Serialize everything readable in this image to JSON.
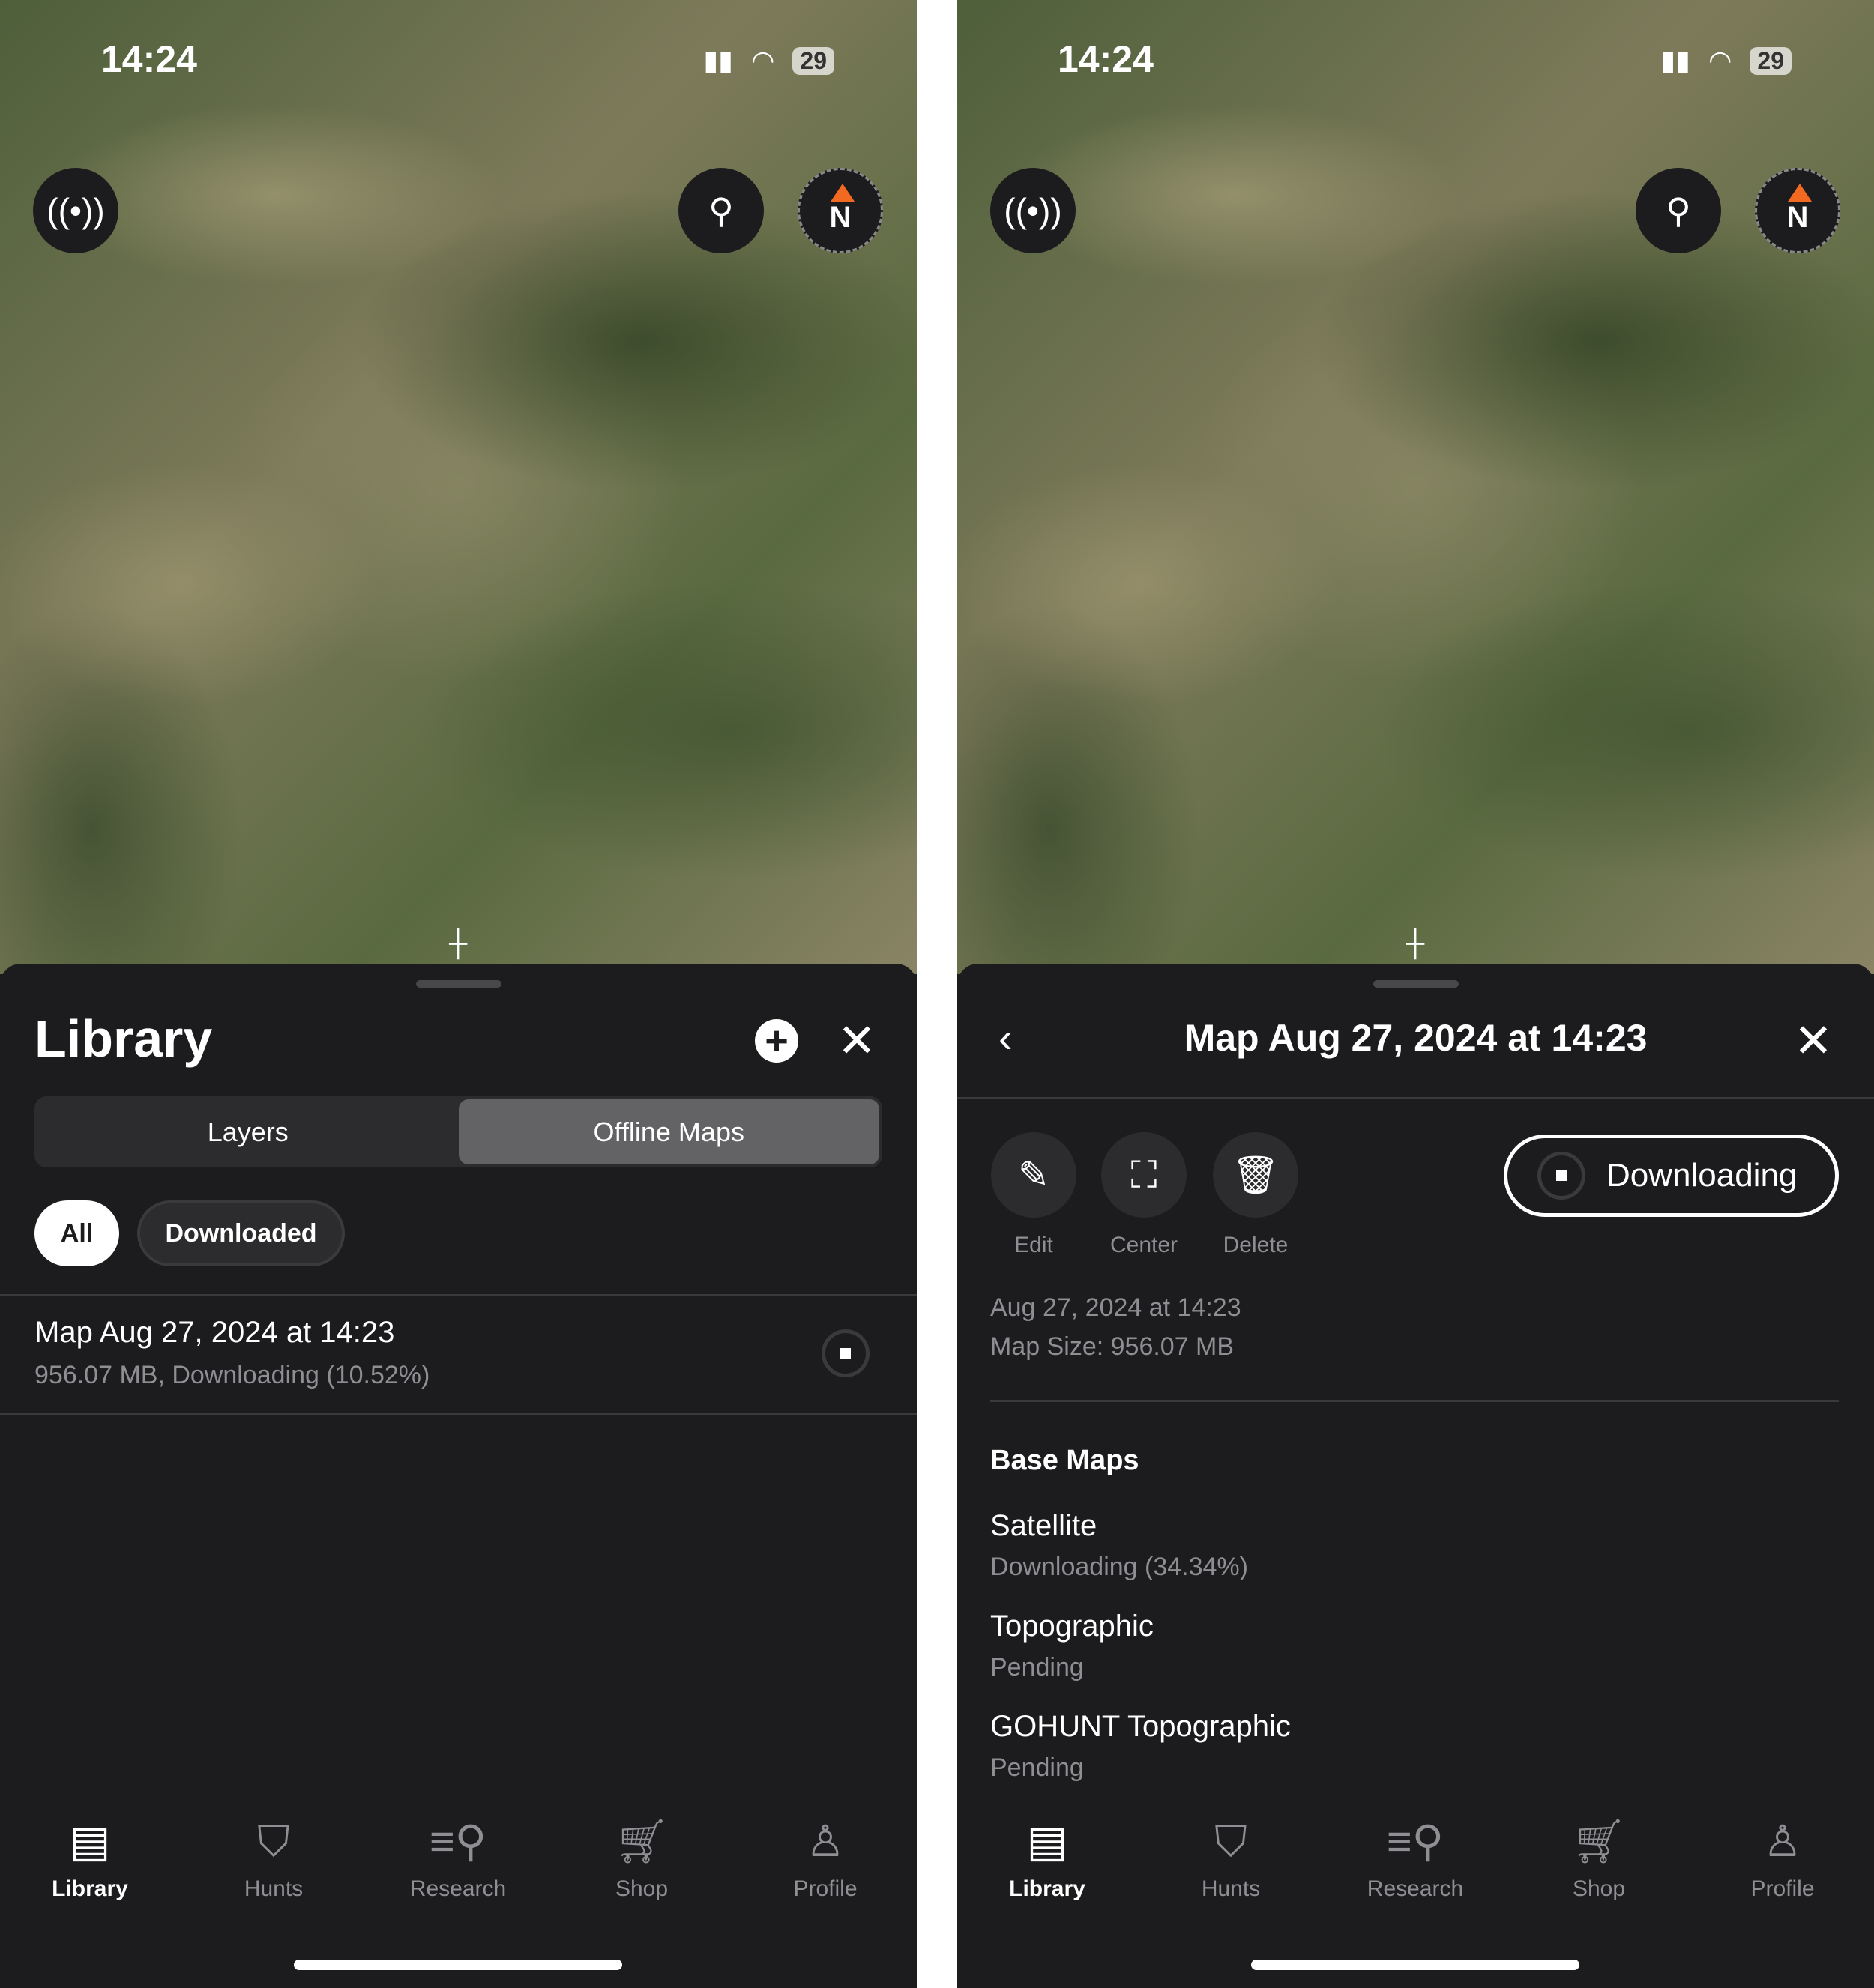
{
  "status": {
    "time": "14:24",
    "battery": "29"
  },
  "left": {
    "sheet_title": "Library",
    "segments": [
      "Layers",
      "Offline Maps"
    ],
    "active_segment": "Offline Maps",
    "filters": [
      "All",
      "Downloaded"
    ],
    "active_filter": "All",
    "item": {
      "title": "Map Aug 27, 2024 at 14:23",
      "subtitle": "956.07 MB, Downloading (10.52%)",
      "progress_percent": 10.52
    }
  },
  "right": {
    "title": "Map Aug 27, 2024 at 14:23",
    "actions": [
      "Edit",
      "Center",
      "Delete"
    ],
    "download_button": "Downloading",
    "date": "Aug 27, 2024 at 14:23",
    "size": "Map Size: 956.07 MB",
    "section": "Base Maps",
    "base_maps": [
      {
        "name": "Satellite",
        "status": "Downloading (34.34%)"
      },
      {
        "name": "Topographic",
        "status": "Pending"
      },
      {
        "name": "GOHUNT Topographic",
        "status": "Pending"
      }
    ]
  },
  "tabs": [
    "Library",
    "Hunts",
    "Research",
    "Shop",
    "Profile"
  ],
  "active_tab": "Library",
  "colors": {
    "compass_arrow": "#f26a21",
    "sheet_bg": "#1c1c1e"
  }
}
